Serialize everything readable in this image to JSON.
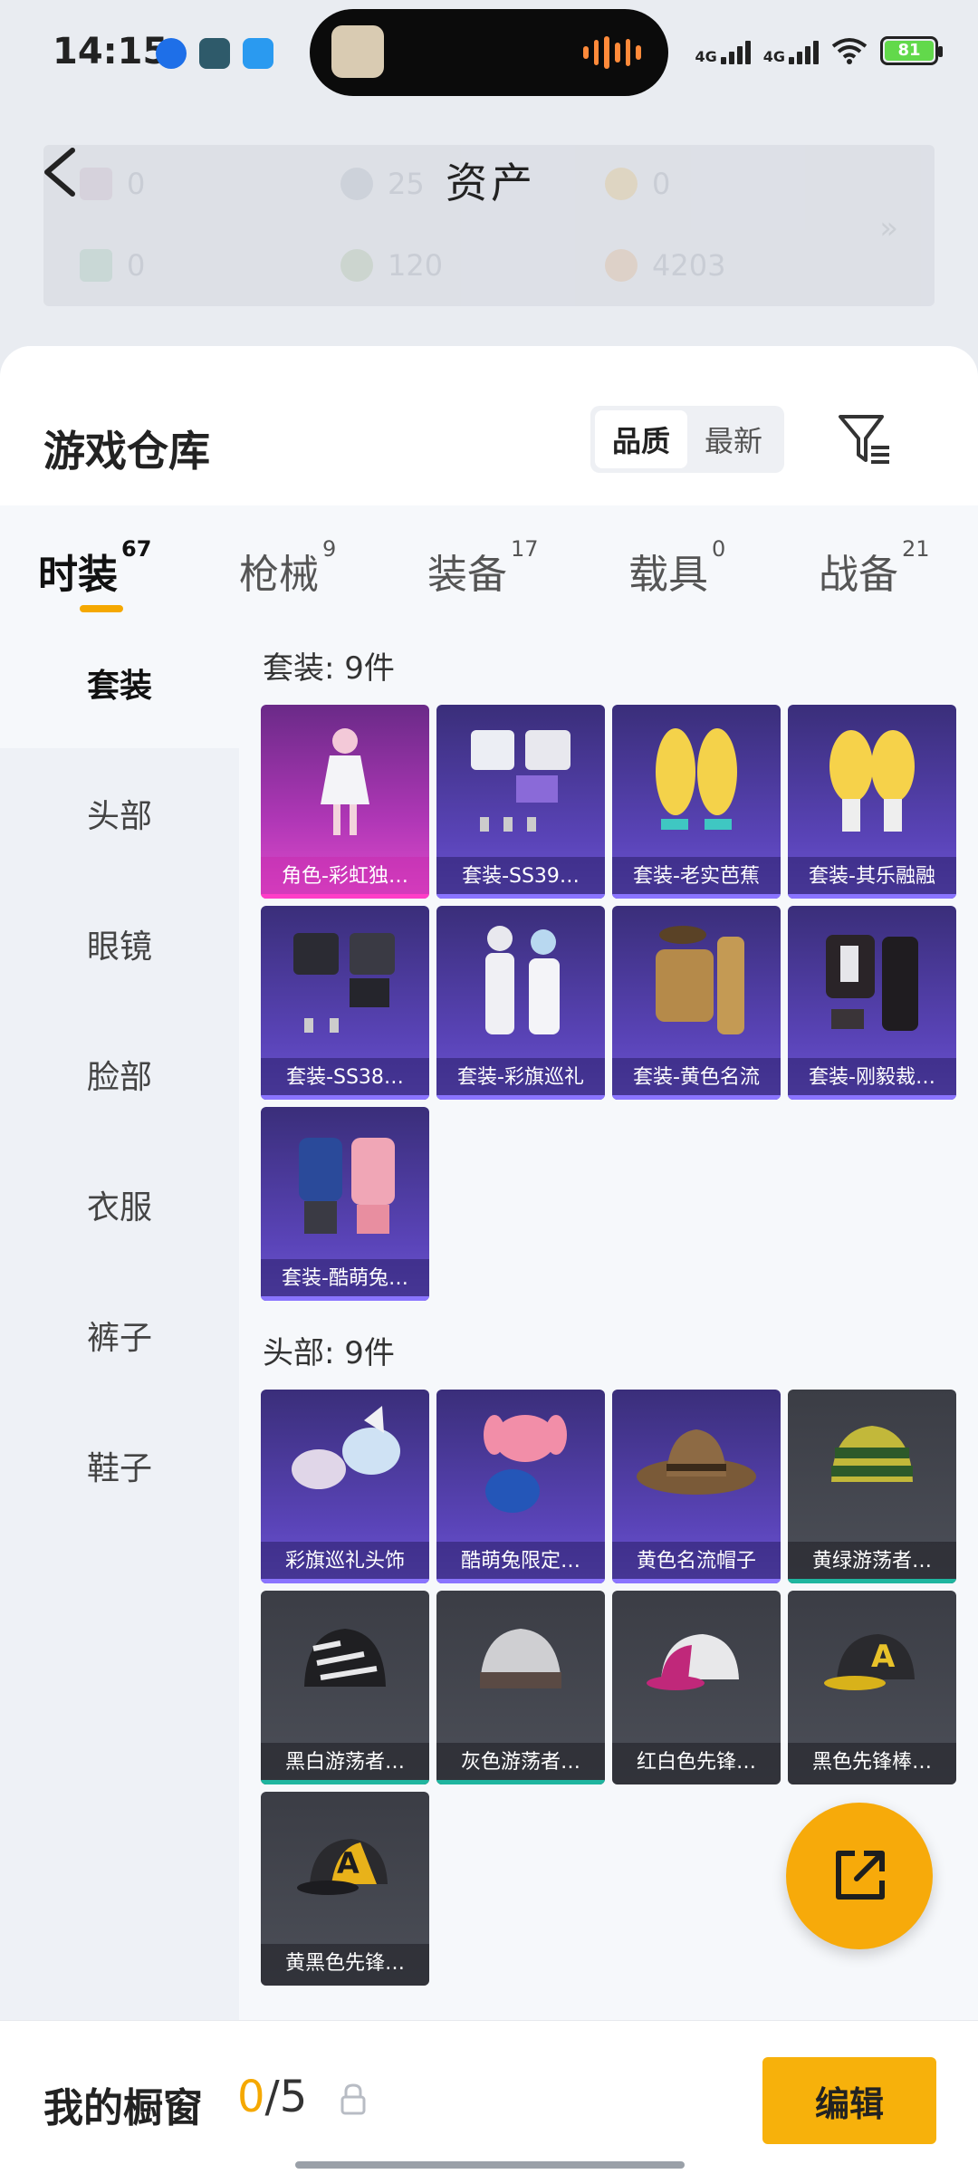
{
  "status_bar": {
    "time": "14:15",
    "network_1": "4G",
    "network_2": "4G",
    "battery": "81"
  },
  "header": {
    "title": "资产",
    "assets": [
      {
        "value": "0"
      },
      {
        "value": "25"
      },
      {
        "value": "0"
      },
      {
        "value": "0"
      },
      {
        "value": "120"
      },
      {
        "value": "4203"
      }
    ],
    "more": "»"
  },
  "warehouse": {
    "title": "游戏仓库",
    "sort_quality": "品质",
    "sort_newest": "最新"
  },
  "tabs": [
    {
      "label": "时装",
      "count": "67"
    },
    {
      "label": "枪械",
      "count": "9"
    },
    {
      "label": "装备",
      "count": "17"
    },
    {
      "label": "载具",
      "count": "0"
    },
    {
      "label": "战备",
      "count": "21"
    }
  ],
  "sidebar": [
    "套装",
    "头部",
    "眼镜",
    "脸部",
    "衣服",
    "裤子",
    "鞋子"
  ],
  "sections": {
    "suits_title": "套装: 9件",
    "suits": [
      "角色-彩虹独…",
      "套装-SS39…",
      "套装-老实芭蕉",
      "套装-其乐融融",
      "套装-SS38…",
      "套装-彩旗巡礼",
      "套装-黄色名流",
      "套装-刚毅裁…",
      "套装-酷萌兔…"
    ],
    "head_title": "头部: 9件",
    "head": [
      "彩旗巡礼头饰",
      "酷萌兔限定…",
      "黄色名流帽子",
      "黄绿游荡者…",
      "黑白游荡者…",
      "灰色游荡者…",
      "红白色先锋…",
      "黑色先锋棒…",
      "黄黑色先锋…"
    ]
  },
  "bottom": {
    "title": "我的橱窗",
    "count_current": "0",
    "count_total": "/5",
    "edit": "编辑"
  },
  "colors": {
    "accent": "#f7aa0a",
    "tile_purple": "#5a44b8",
    "tile_pink": "#d046c2",
    "tile_gray": "#4a4d56"
  }
}
